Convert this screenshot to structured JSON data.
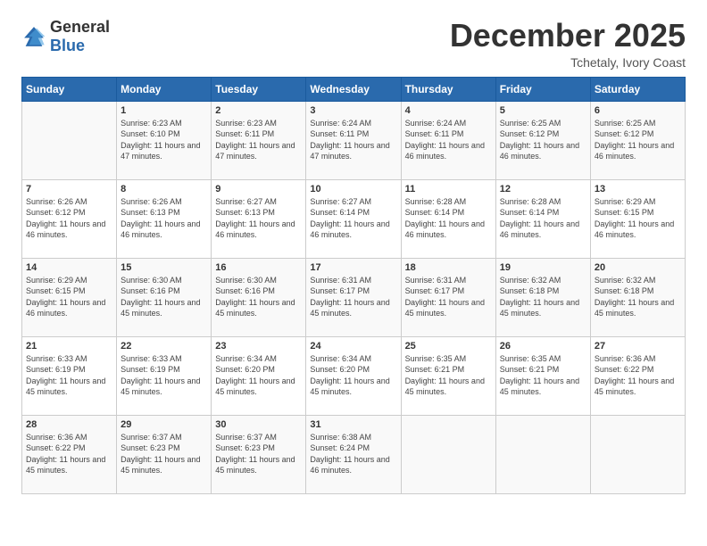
{
  "logo": {
    "text_general": "General",
    "text_blue": "Blue"
  },
  "title": "December 2025",
  "location": "Tchetaly, Ivory Coast",
  "days_of_week": [
    "Sunday",
    "Monday",
    "Tuesday",
    "Wednesday",
    "Thursday",
    "Friday",
    "Saturday"
  ],
  "weeks": [
    [
      {
        "day": "",
        "info": ""
      },
      {
        "day": "1",
        "info": "Sunrise: 6:23 AM\nSunset: 6:10 PM\nDaylight: 11 hours and 47 minutes."
      },
      {
        "day": "2",
        "info": "Sunrise: 6:23 AM\nSunset: 6:11 PM\nDaylight: 11 hours and 47 minutes."
      },
      {
        "day": "3",
        "info": "Sunrise: 6:24 AM\nSunset: 6:11 PM\nDaylight: 11 hours and 47 minutes."
      },
      {
        "day": "4",
        "info": "Sunrise: 6:24 AM\nSunset: 6:11 PM\nDaylight: 11 hours and 46 minutes."
      },
      {
        "day": "5",
        "info": "Sunrise: 6:25 AM\nSunset: 6:12 PM\nDaylight: 11 hours and 46 minutes."
      },
      {
        "day": "6",
        "info": "Sunrise: 6:25 AM\nSunset: 6:12 PM\nDaylight: 11 hours and 46 minutes."
      }
    ],
    [
      {
        "day": "7",
        "info": "Sunrise: 6:26 AM\nSunset: 6:12 PM\nDaylight: 11 hours and 46 minutes."
      },
      {
        "day": "8",
        "info": "Sunrise: 6:26 AM\nSunset: 6:13 PM\nDaylight: 11 hours and 46 minutes."
      },
      {
        "day": "9",
        "info": "Sunrise: 6:27 AM\nSunset: 6:13 PM\nDaylight: 11 hours and 46 minutes."
      },
      {
        "day": "10",
        "info": "Sunrise: 6:27 AM\nSunset: 6:14 PM\nDaylight: 11 hours and 46 minutes."
      },
      {
        "day": "11",
        "info": "Sunrise: 6:28 AM\nSunset: 6:14 PM\nDaylight: 11 hours and 46 minutes."
      },
      {
        "day": "12",
        "info": "Sunrise: 6:28 AM\nSunset: 6:14 PM\nDaylight: 11 hours and 46 minutes."
      },
      {
        "day": "13",
        "info": "Sunrise: 6:29 AM\nSunset: 6:15 PM\nDaylight: 11 hours and 46 minutes."
      }
    ],
    [
      {
        "day": "14",
        "info": "Sunrise: 6:29 AM\nSunset: 6:15 PM\nDaylight: 11 hours and 46 minutes."
      },
      {
        "day": "15",
        "info": "Sunrise: 6:30 AM\nSunset: 6:16 PM\nDaylight: 11 hours and 45 minutes."
      },
      {
        "day": "16",
        "info": "Sunrise: 6:30 AM\nSunset: 6:16 PM\nDaylight: 11 hours and 45 minutes."
      },
      {
        "day": "17",
        "info": "Sunrise: 6:31 AM\nSunset: 6:17 PM\nDaylight: 11 hours and 45 minutes."
      },
      {
        "day": "18",
        "info": "Sunrise: 6:31 AM\nSunset: 6:17 PM\nDaylight: 11 hours and 45 minutes."
      },
      {
        "day": "19",
        "info": "Sunrise: 6:32 AM\nSunset: 6:18 PM\nDaylight: 11 hours and 45 minutes."
      },
      {
        "day": "20",
        "info": "Sunrise: 6:32 AM\nSunset: 6:18 PM\nDaylight: 11 hours and 45 minutes."
      }
    ],
    [
      {
        "day": "21",
        "info": "Sunrise: 6:33 AM\nSunset: 6:19 PM\nDaylight: 11 hours and 45 minutes."
      },
      {
        "day": "22",
        "info": "Sunrise: 6:33 AM\nSunset: 6:19 PM\nDaylight: 11 hours and 45 minutes."
      },
      {
        "day": "23",
        "info": "Sunrise: 6:34 AM\nSunset: 6:20 PM\nDaylight: 11 hours and 45 minutes."
      },
      {
        "day": "24",
        "info": "Sunrise: 6:34 AM\nSunset: 6:20 PM\nDaylight: 11 hours and 45 minutes."
      },
      {
        "day": "25",
        "info": "Sunrise: 6:35 AM\nSunset: 6:21 PM\nDaylight: 11 hours and 45 minutes."
      },
      {
        "day": "26",
        "info": "Sunrise: 6:35 AM\nSunset: 6:21 PM\nDaylight: 11 hours and 45 minutes."
      },
      {
        "day": "27",
        "info": "Sunrise: 6:36 AM\nSunset: 6:22 PM\nDaylight: 11 hours and 45 minutes."
      }
    ],
    [
      {
        "day": "28",
        "info": "Sunrise: 6:36 AM\nSunset: 6:22 PM\nDaylight: 11 hours and 45 minutes."
      },
      {
        "day": "29",
        "info": "Sunrise: 6:37 AM\nSunset: 6:23 PM\nDaylight: 11 hours and 45 minutes."
      },
      {
        "day": "30",
        "info": "Sunrise: 6:37 AM\nSunset: 6:23 PM\nDaylight: 11 hours and 45 minutes."
      },
      {
        "day": "31",
        "info": "Sunrise: 6:38 AM\nSunset: 6:24 PM\nDaylight: 11 hours and 46 minutes."
      },
      {
        "day": "",
        "info": ""
      },
      {
        "day": "",
        "info": ""
      },
      {
        "day": "",
        "info": ""
      }
    ]
  ]
}
